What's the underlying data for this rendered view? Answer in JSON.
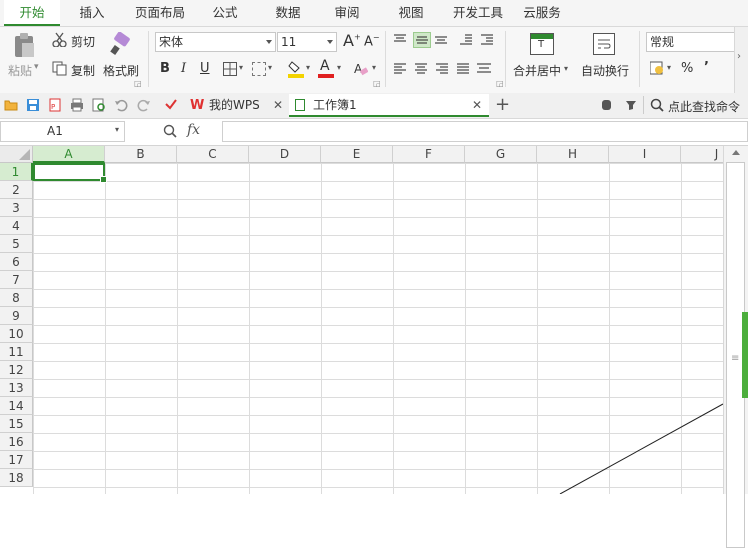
{
  "menu": {
    "tabs": [
      "开始",
      "插入",
      "页面布局",
      "公式",
      "数据",
      "审阅",
      "视图",
      "开发工具",
      "云服务"
    ],
    "active_index": 0
  },
  "ribbon": {
    "paste": "粘贴",
    "cut": "剪切",
    "copy": "复制",
    "format_painter": "格式刷",
    "font_name": "宋体",
    "font_size": "11",
    "bold": "B",
    "italic": "I",
    "underline": "U",
    "font_color_letter": "A",
    "merge_center": "合并居中",
    "wrap_text": "自动换行",
    "number_format": "常规",
    "percent": "%",
    "comma": "’"
  },
  "quickbar": {
    "tabs": [
      {
        "label": "我的WPS",
        "active": false
      },
      {
        "label": "工作簿1",
        "active": true
      }
    ],
    "search": "点此查找命令",
    "add_tab": "+"
  },
  "formula": {
    "cell_ref": "A1",
    "fx": "fx",
    "value": ""
  },
  "sheet": {
    "columns": [
      "A",
      "B",
      "C",
      "D",
      "E",
      "F",
      "G",
      "H",
      "I",
      "J"
    ],
    "rows": [
      "1",
      "2",
      "3",
      "4",
      "5",
      "6",
      "7",
      "8",
      "9",
      "10",
      "11",
      "12",
      "13",
      "14",
      "15",
      "16",
      "17",
      "18"
    ],
    "selected_cell": "A1"
  },
  "colors": {
    "accent": "#2f8a2f",
    "grid_line": "#d9d9d9",
    "header_bg": "#f2f2f2"
  }
}
